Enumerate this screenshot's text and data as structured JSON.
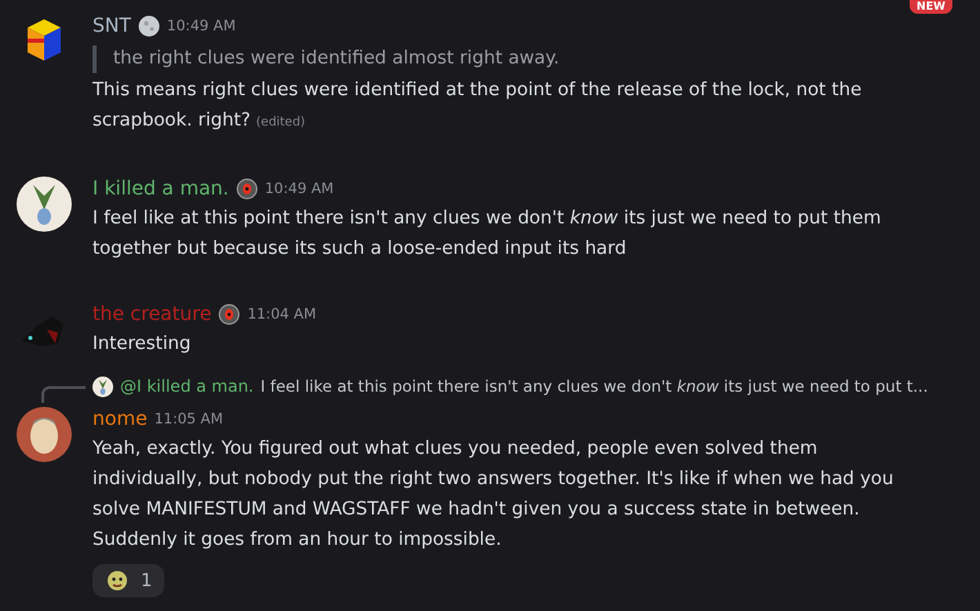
{
  "badge": "NEW",
  "messages": [
    {
      "author": "SNT",
      "color": "#a8b4c4",
      "time": "10:49 AM",
      "quote": "the right clues were identified almost right away.",
      "text": "This means right clues were identified at the point of the release of the lock, not the scrapbook. right?",
      "edited": "(edited)"
    },
    {
      "author": "I killed a man.",
      "color": "#5fb56b",
      "time": "10:49 AM",
      "text": "I feel like at this point there isn't any clues we don't *know* its just we need to put them together but because its such a loose-ended input its hard"
    },
    {
      "author": "the creature",
      "color": "#b3201c",
      "time": "11:04 AM",
      "text": "Interesting"
    },
    {
      "author": "nome",
      "color": "#e8760c",
      "time": "11:05 AM",
      "reply": {
        "mention": "@I killed a man.",
        "text": "I feel like at this point there isn't any clues we don't *know* its just we need to put t..."
      },
      "text": "Yeah, exactly. You figured out what clues you needed, people even solved them individually, but nobody put the right two answers together. It's like if when we had you solve MANIFESTUM and WAGSTAFF we hadn't given you a success state in between. Suddenly it goes from an hour to impossible.",
      "reactions": [
        {
          "count": "1"
        }
      ]
    }
  ]
}
